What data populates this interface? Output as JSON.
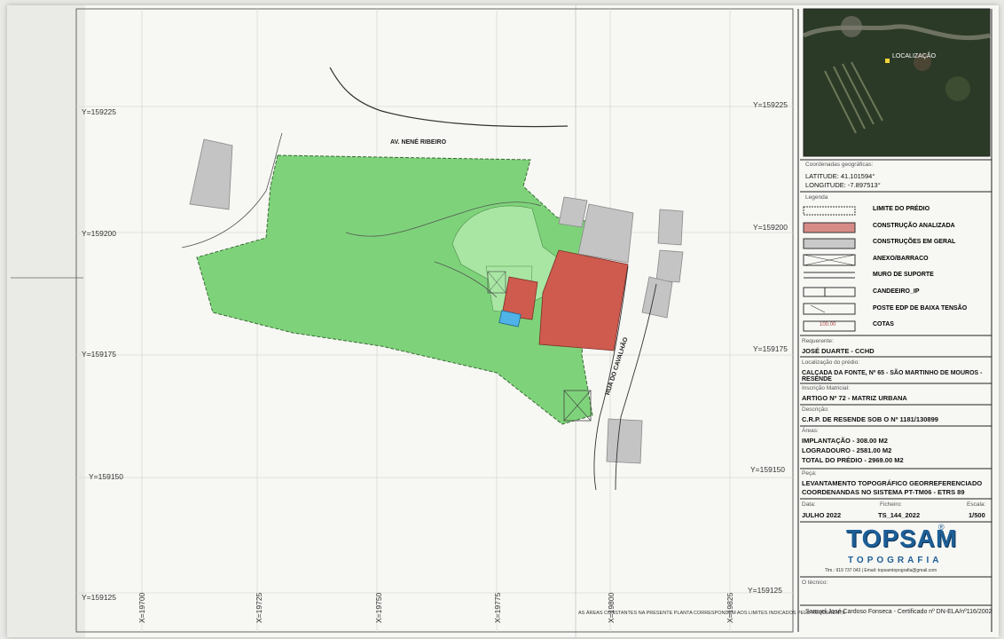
{
  "grid": {
    "y_labels": [
      "Y=159225",
      "Y=159200",
      "Y=159175",
      "Y=159150",
      "Y=159125"
    ],
    "x_labels": [
      "X=19700",
      "X=19725",
      "X=19750",
      "X=19775",
      "X=19800",
      "X=19825"
    ]
  },
  "streets": {
    "north": "AV. NENÉ RIBEIRO",
    "east": "RUA DO CAVALHÃO"
  },
  "bottom_note": "AS ÁREAS CONSTANTES NA PRESENTE PLANTA CORRESPONDEM AOS LIMITES INDICADOS PELO REQUERENTE",
  "satellite": {
    "label": "LOCALIZAÇÃO"
  },
  "coordinates": {
    "title": "Coordenadas geográficas:",
    "latitude": "LATITUDE: 41.101594°",
    "longitude": "LONGITUDE: -7.897513°"
  },
  "legend": {
    "title": "Legenda",
    "items": [
      {
        "label": "LIMITE DO PRÉDIO",
        "icon": "dashed-boundary"
      },
      {
        "label": "CONSTRUÇÃO ANALIZADA",
        "icon": "red-fill",
        "color": "#d78b86"
      },
      {
        "label": "CONSTRUÇÕES EM GERAL",
        "icon": "grey-fill",
        "color": "#c9c9c9"
      },
      {
        "label": "ANEXO/BARRACO",
        "icon": "crossed-box"
      },
      {
        "label": "MURO DE SUPORTE",
        "icon": "double-line"
      },
      {
        "label": "CANDEEIRO_IP",
        "icon": "lamp"
      },
      {
        "label": "POSTE EDP DE BAIXA TENSÃO",
        "icon": "pole"
      },
      {
        "label": "COTAS",
        "icon": "elevation",
        "sample": "100.00"
      }
    ]
  },
  "requerente": {
    "title": "Requerente:",
    "value": "JOSÉ DUARTE - CCHD"
  },
  "localizacao": {
    "title": "Localização do prédio:",
    "value": "CALÇADA DA FONTE, Nº 65 - SÃO MARTINHO DE MOUROS - RESENDE"
  },
  "inscricao": {
    "title": "Inscrição Matricial:",
    "value": "ARTIGO Nº 72 - MATRIZ URBANA"
  },
  "descricao": {
    "title": "Descrição:",
    "value": "C.R.P. DE RESENDE SOB O Nº 1181/130899"
  },
  "areas": {
    "title": "Áreas:",
    "implantacao": "IMPLANTAÇÃO - 308.00 M2",
    "logradouro": "LOGRADOURO - 2581.00 M2",
    "total": "TOTAL DO PRÉDIO - 2969.00 M2"
  },
  "peca": {
    "title": "Peça:",
    "line1": "LEVANTAMENTO TOPOGRÁFICO GEORREFERENCIADO",
    "line2": "COORDENANDAS NO SISTEMA PT-TM06 - ETRS 89"
  },
  "meta": {
    "data_title": "Data:",
    "data_value": "JULHO 2022",
    "ficheiro_title": "Ficheiro:",
    "ficheiro_value": "TS_144_2022",
    "escala_title": "Escala:",
    "escala_value": "1/500"
  },
  "logo": {
    "name": "TOPSAM",
    "registered": "®",
    "subtitle": "TOPOGRAFIA",
    "contact": "Tlm.: 919 737 043 | Email: topsamtopografia@gmail.com"
  },
  "tecnico": {
    "title": "O técnico:",
    "signature": "Samuel José Cardoso Fonseca - Certificado nº DN-ELA/nº116/2002"
  },
  "colors": {
    "parcel": "#7ed37a",
    "parcel_light": "#a9e6a4",
    "built_analysed": "#cf5a4e",
    "buildings": "#c4c4c4",
    "pool": "#4fb3e8"
  }
}
